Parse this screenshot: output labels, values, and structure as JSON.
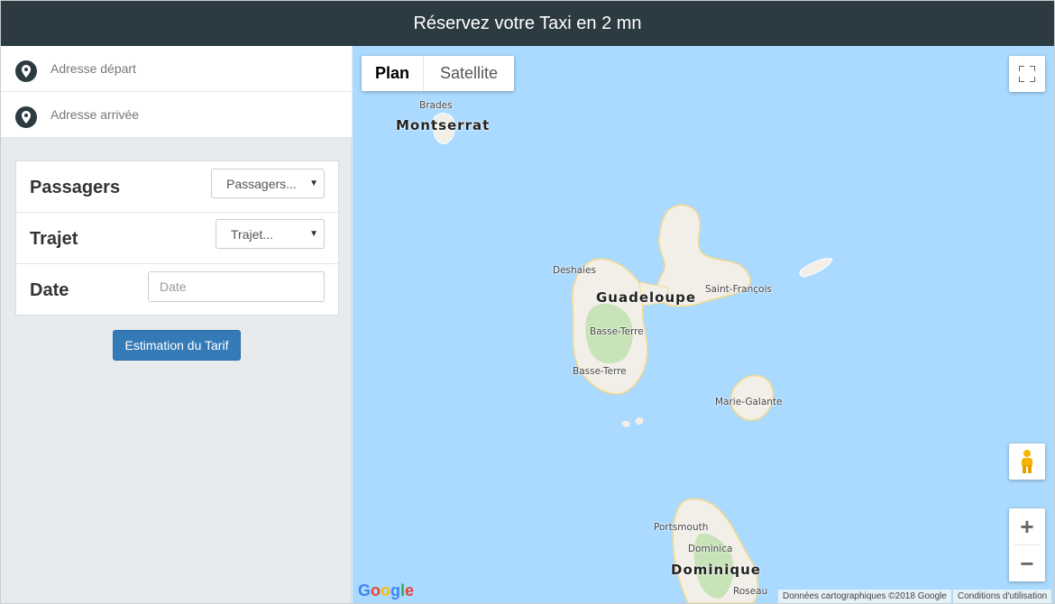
{
  "header": {
    "title": "Réservez votre Taxi en 2 mn"
  },
  "address": {
    "departure_placeholder": "Adresse départ",
    "arrival_placeholder": "Adresse arrivée",
    "icon": "map-pin-icon"
  },
  "form": {
    "passengers": {
      "label": "Passagers",
      "selected": "Passagers..."
    },
    "trip": {
      "label": "Trajet",
      "selected": "Trajet..."
    },
    "date": {
      "label": "Date",
      "placeholder": "Date"
    }
  },
  "estimate_button": "Estimation du Tarif",
  "map": {
    "type_tabs": {
      "plan": "Plan",
      "satellite": "Satellite"
    },
    "zoom_in": "+",
    "zoom_out": "−",
    "labels": {
      "brades": "Brades",
      "montserrat": "Montserrat",
      "deshaies": "Deshaies",
      "guadeloupe": "Guadeloupe",
      "saint_francois": "Saint-François",
      "basse_terre_1": "Basse-Terre",
      "basse_terre_2": "Basse-Terre",
      "marie_galante": "Marie-Galante",
      "portsmouth": "Portsmouth",
      "dominica": "Dominica",
      "dominique": "Dominique",
      "roseau": "Roseau"
    },
    "logo": "Google",
    "attribution": "Données cartographiques ©2018 Google",
    "terms": "Conditions d'utilisation"
  },
  "colors": {
    "header_bg": "#2c3a42",
    "sea": "#aadaff",
    "button": "#337ab7"
  }
}
